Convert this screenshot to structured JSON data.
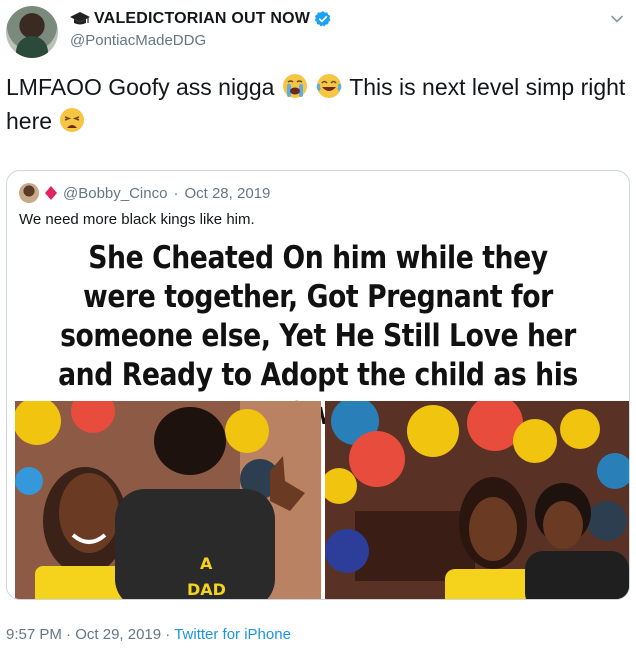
{
  "author": {
    "display_name": "VALEDICTORIAN OUT NOW",
    "handle": "@PontiacMadeDDG",
    "verified": true
  },
  "tweet": {
    "text_part1": "LMFAOO Goofy ass nigga ",
    "text_part2": " This is next level simp right here ",
    "emojis": [
      "loudly-crying-face",
      "face-with-tears-of-joy",
      "weary-face"
    ]
  },
  "quoted_tweet": {
    "handle": "@Bobby_Cinco",
    "separator": "·",
    "date": "Oct 28, 2019",
    "text": "We need more black kings like him.",
    "media_headline": "She Cheated On him while they were together, Got Pregnant for someone else, Yet He Still Love her and Ready to Adopt the child as his Own",
    "shirt_text_line1": "A",
    "shirt_text_line2": "DAD"
  },
  "footer": {
    "time": "9:57 PM",
    "separator1": "·",
    "date": "Oct 29, 2019",
    "separator2": "·",
    "source": "Twitter for iPhone"
  },
  "colors": {
    "link": "#1b95e0",
    "secondary_text": "#657786",
    "border": "#ccd6dd",
    "verified": "#1da1f2"
  }
}
